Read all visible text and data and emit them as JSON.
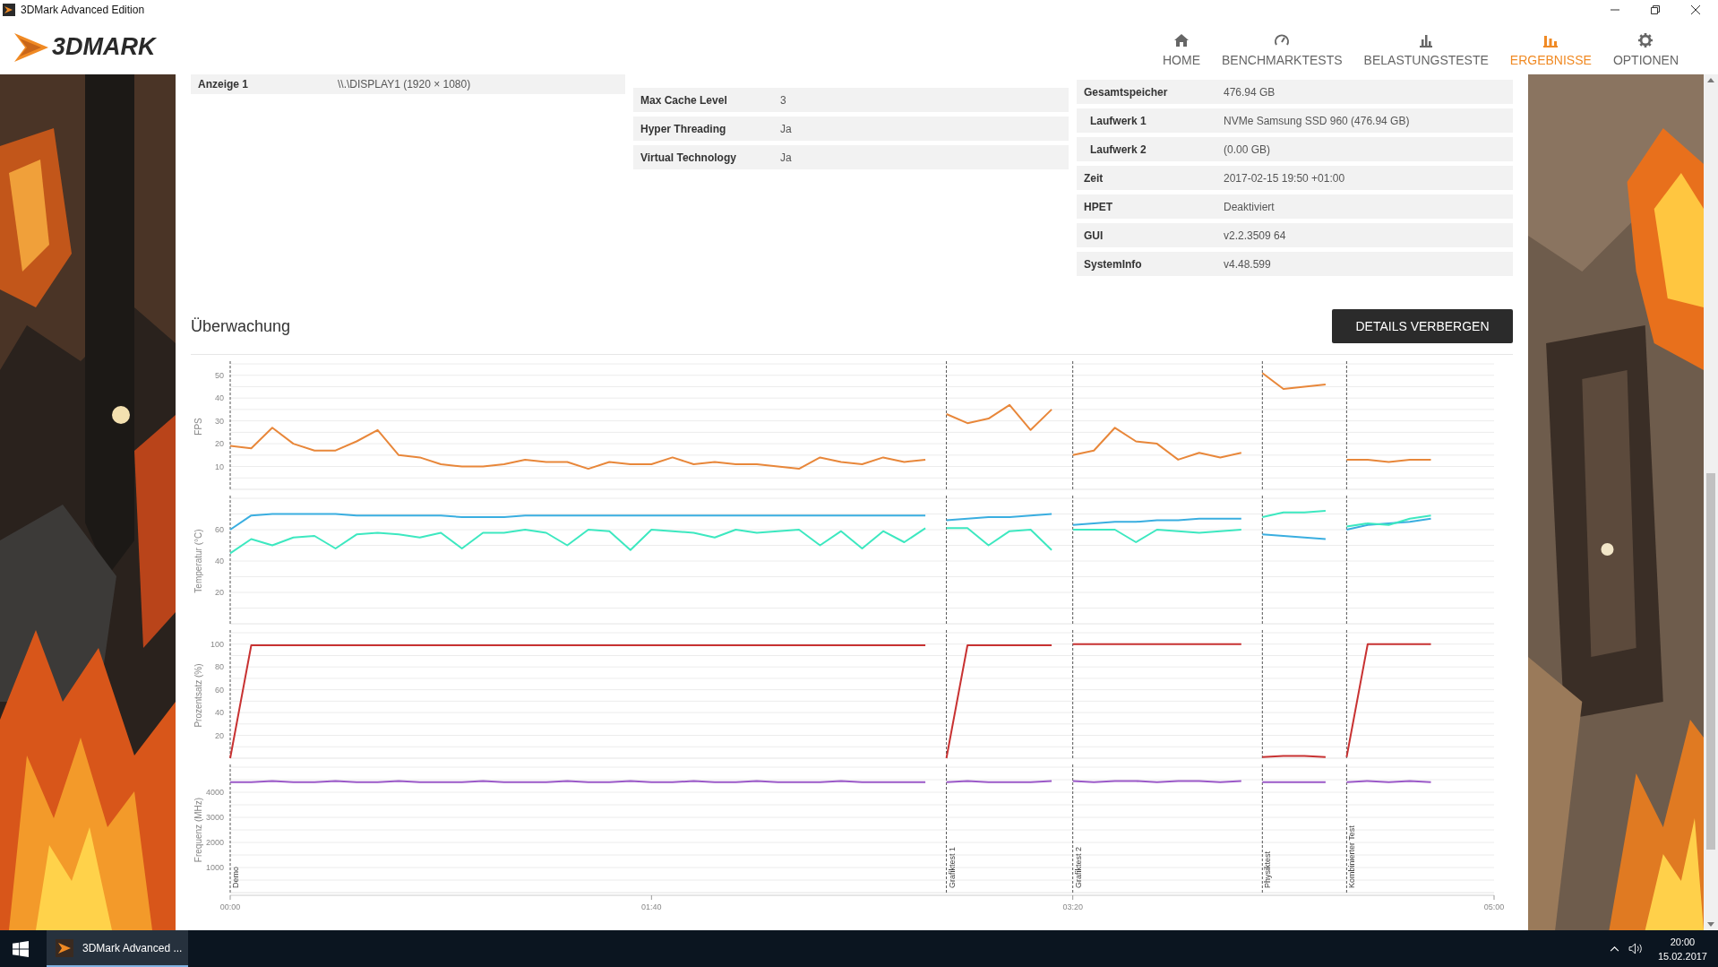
{
  "window": {
    "title": "3DMark Advanced Edition"
  },
  "header": {
    "logo": "3DMARK",
    "nav": [
      {
        "label": "HOME",
        "kind": "home",
        "selected": false
      },
      {
        "label": "BENCHMARKTESTS",
        "kind": "gauge",
        "selected": false
      },
      {
        "label": "BELASTUNGSTESTE",
        "kind": "chart",
        "selected": false
      },
      {
        "label": "ERGEBNISSE",
        "kind": "bars",
        "selected": true
      },
      {
        "label": "OPTIONEN",
        "kind": "gear",
        "selected": false
      }
    ]
  },
  "system_info": {
    "tables": [
      {
        "rows": [
          {
            "label": "Anzeige 1",
            "value": "\\\\.\\DISPLAY1 (1920 × 1080)",
            "indented": false
          }
        ]
      },
      {
        "rows": [
          {
            "label": "Max Cache Level",
            "value": "3",
            "indented": false
          },
          {
            "label": "Hyper Threading",
            "value": "Ja",
            "indented": false
          },
          {
            "label": "Virtual Technology",
            "value": "Ja",
            "indented": false
          }
        ]
      },
      {
        "rows": [
          {
            "label": "Gesamtspeicher",
            "value": "476.94 GB",
            "indented": false
          },
          {
            "label": "Laufwerk 1",
            "value": "NVMe Samsung SSD 960 (476.94 GB)",
            "indented": true
          },
          {
            "label": "Laufwerk 2",
            "value": "(0.00 GB)",
            "indented": true
          },
          {
            "label": "Zeit",
            "value": "2017-02-15 19:50 +01:00",
            "indented": false
          },
          {
            "label": "HPET",
            "value": "Deaktiviert",
            "indented": false
          },
          {
            "label": "GUI",
            "value": "v2.2.3509 64",
            "indented": false
          },
          {
            "label": "SystemInfo",
            "value": "v4.48.599",
            "indented": false
          }
        ]
      }
    ]
  },
  "monitoring": {
    "title": "Überwachung",
    "toggle_button": "DETAILS VERBERGEN",
    "charts": [
      {
        "chart_data": {
          "type": "line",
          "ylabel": "FPS",
          "xlim": [
            0,
            300
          ],
          "ylim": [
            0,
            55
          ],
          "yticks": [
            10,
            20,
            30,
            40,
            50
          ],
          "x": [
            0,
            5,
            10,
            15,
            20,
            25,
            30,
            35,
            40,
            45,
            50,
            55,
            60,
            65,
            70,
            75,
            80,
            85,
            90,
            95,
            100,
            105,
            110,
            115,
            120,
            125,
            130,
            135,
            140,
            145,
            150,
            155,
            160,
            165,
            170,
            175,
            180,
            185,
            190,
            195,
            200,
            205,
            210,
            215,
            220,
            225,
            230,
            235,
            240,
            245,
            250,
            255,
            260,
            265,
            270,
            275,
            280,
            285
          ],
          "series": [
            {
              "color": "#e8873a",
              "values": [
                19,
                18,
                27,
                20,
                17,
                17,
                21,
                26,
                15,
                14,
                11,
                10,
                10,
                11,
                13,
                12,
                12,
                9,
                12,
                11,
                11,
                14,
                11,
                12,
                11,
                11,
                10,
                9,
                14,
                12,
                11,
                14,
                12,
                13,
                33,
                29,
                31,
                37,
                26,
                35,
                15,
                17,
                27,
                21,
                20,
                13,
                16,
                14,
                16,
                51,
                44,
                45,
                46,
                13,
                13,
                12,
                13,
                13
              ]
            }
          ],
          "grid": true
        }
      },
      {
        "chart_data": {
          "type": "line",
          "ylabel": "Temperatur (°C)",
          "xlim": [
            0,
            300
          ],
          "ylim": [
            0,
            80
          ],
          "yticks": [
            20,
            40,
            60
          ],
          "x": [
            0,
            5,
            10,
            15,
            20,
            25,
            30,
            35,
            40,
            45,
            50,
            55,
            60,
            65,
            70,
            75,
            80,
            85,
            90,
            95,
            100,
            105,
            110,
            115,
            120,
            125,
            130,
            135,
            140,
            145,
            150,
            155,
            160,
            165,
            170,
            175,
            180,
            185,
            190,
            195,
            200,
            205,
            210,
            215,
            220,
            225,
            230,
            235,
            240,
            245,
            250,
            255,
            260,
            265,
            270,
            275,
            280,
            285
          ],
          "series": [
            {
              "color": "#3aaee0",
              "values": [
                60,
                69,
                70,
                70,
                70,
                70,
                69,
                69,
                69,
                69,
                69,
                68,
                68,
                68,
                69,
                69,
                69,
                69,
                69,
                69,
                69,
                69,
                69,
                69,
                69,
                69,
                69,
                69,
                69,
                69,
                69,
                69,
                69,
                69,
                66,
                67,
                68,
                68,
                69,
                70,
                63,
                64,
                65,
                65,
                66,
                66,
                67,
                67,
                67,
                57,
                56,
                55,
                54,
                60,
                63,
                64,
                65,
                67
              ]
            },
            {
              "color": "#3de8c0",
              "values": [
                45,
                54,
                50,
                55,
                56,
                48,
                57,
                58,
                57,
                55,
                58,
                48,
                58,
                58,
                60,
                58,
                50,
                60,
                59,
                47,
                60,
                59,
                58,
                55,
                60,
                58,
                59,
                60,
                50,
                59,
                48,
                59,
                52,
                61,
                61,
                61,
                50,
                59,
                60,
                47,
                60,
                60,
                60,
                52,
                60,
                59,
                58,
                59,
                60,
                68,
                71,
                71,
                72,
                62,
                64,
                63,
                67,
                69
              ]
            }
          ],
          "grid": true
        }
      },
      {
        "chart_data": {
          "type": "line",
          "ylabel": "Prozentsatz (%)",
          "xlim": [
            0,
            300
          ],
          "ylim": [
            0,
            110
          ],
          "yticks": [
            20,
            40,
            60,
            80,
            100
          ],
          "x": [
            0,
            5,
            10,
            15,
            20,
            25,
            30,
            35,
            40,
            45,
            50,
            55,
            60,
            65,
            70,
            75,
            80,
            85,
            90,
            95,
            100,
            105,
            110,
            115,
            120,
            125,
            130,
            135,
            140,
            145,
            150,
            155,
            160,
            165,
            170,
            175,
            180,
            185,
            190,
            195,
            200,
            205,
            210,
            215,
            220,
            225,
            230,
            235,
            240,
            245,
            250,
            255,
            260,
            265,
            270,
            275,
            280,
            285
          ],
          "series": [
            {
              "color": "#c83232",
              "values": [
                0,
                99,
                99,
                99,
                99,
                99,
                99,
                99,
                99,
                99,
                99,
                99,
                99,
                99,
                99,
                99,
                99,
                99,
                99,
                99,
                99,
                99,
                99,
                99,
                99,
                99,
                99,
                99,
                99,
                99,
                99,
                99,
                99,
                99,
                0,
                99,
                99,
                99,
                99,
                99,
                100,
                100,
                100,
                100,
                100,
                100,
                100,
                100,
                100,
                1,
                2,
                2,
                1,
                1,
                100,
                100,
                100,
                100
              ]
            }
          ],
          "grid": true
        }
      },
      {
        "chart_data": {
          "type": "line",
          "ylabel": "Frequenz (MHz)",
          "xlim": [
            0,
            300
          ],
          "ylim": [
            0,
            5000
          ],
          "yticks": [
            1000,
            2000,
            3000,
            4000
          ],
          "xticks": [
            {
              "value": 0,
              "label": "00:00"
            },
            {
              "value": 100,
              "label": "01:40"
            },
            {
              "value": 200,
              "label": "03:20"
            },
            {
              "value": 300,
              "label": "05:00"
            }
          ],
          "x": [
            0,
            5,
            10,
            15,
            20,
            25,
            30,
            35,
            40,
            45,
            50,
            55,
            60,
            65,
            70,
            75,
            80,
            85,
            90,
            95,
            100,
            105,
            110,
            115,
            120,
            125,
            130,
            135,
            140,
            145,
            150,
            155,
            160,
            165,
            170,
            175,
            180,
            185,
            190,
            195,
            200,
            205,
            210,
            215,
            220,
            225,
            230,
            235,
            240,
            245,
            250,
            255,
            260,
            265,
            270,
            275,
            280,
            285
          ],
          "series": [
            {
              "color": "#9b59c8",
              "values": [
                4400,
                4400,
                4450,
                4400,
                4400,
                4450,
                4400,
                4400,
                4450,
                4400,
                4400,
                4400,
                4450,
                4400,
                4400,
                4400,
                4450,
                4400,
                4400,
                4450,
                4400,
                4400,
                4450,
                4400,
                4400,
                4450,
                4400,
                4400,
                4400,
                4450,
                4400,
                4400,
                4400,
                4400,
                4400,
                4450,
                4400,
                4400,
                4400,
                4450,
                4450,
                4400,
                4450,
                4450,
                4400,
                4450,
                4450,
                4400,
                4450,
                4400,
                4400,
                4400,
                4400,
                4400,
                4450,
                4400,
                4450,
                4400
              ]
            }
          ],
          "grid": true,
          "ref_lines": [
            {
              "axis": "x",
              "value": 0,
              "label": "Demo"
            },
            {
              "axis": "x",
              "value": 170,
              "label": "Grafiktest 1"
            },
            {
              "axis": "x",
              "value": 200,
              "label": "Grafiktest 2"
            },
            {
              "axis": "x",
              "value": 245,
              "label": "Physiktest"
            },
            {
              "axis": "x",
              "value": 265,
              "label": "Kombinierter Test"
            }
          ]
        }
      }
    ]
  },
  "taskbar": {
    "app_button": "3DMark Advanced ...",
    "time": "20:00",
    "date": "15.02.2017"
  }
}
